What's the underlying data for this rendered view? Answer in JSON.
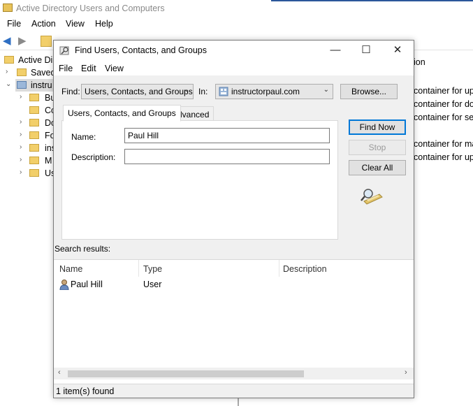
{
  "background_window": {
    "title": "Active Directory Users and Computers",
    "menu": [
      "File",
      "Action",
      "View",
      "Help"
    ],
    "tree": [
      {
        "label": "Active Dir",
        "chevron": ""
      },
      {
        "label": "Saved",
        "chevron": "›"
      },
      {
        "label": "instru",
        "chevron": "⌄"
      },
      {
        "label": "Bu",
        "chevron": "›"
      },
      {
        "label": "Co",
        "chevron": ""
      },
      {
        "label": "Do",
        "chevron": "›"
      },
      {
        "label": "Fo",
        "chevron": "›"
      },
      {
        "label": "ins",
        "chevron": "›"
      },
      {
        "label": "M",
        "chevron": "›"
      },
      {
        "label": "Us",
        "chevron": "›"
      }
    ],
    "right_pane_text": [
      "ion",
      "container for up",
      "container for do",
      "container for sec",
      "container for ma",
      "container for up"
    ]
  },
  "dialog": {
    "title": "Find Users, Contacts, and Groups",
    "menu": [
      "File",
      "Edit",
      "View"
    ],
    "find_label": "Find:",
    "find_value": "Users, Contacts, and Groups",
    "in_label": "In:",
    "in_value": "instructorpaul.com",
    "browse_button": "Browse...",
    "tabs": [
      "Users, Contacts, and Groups",
      "Advanced"
    ],
    "name_label": "Name:",
    "name_value": "Paul Hill",
    "description_label": "Description:",
    "description_value": "",
    "find_now_button": "Find Now",
    "stop_button": "Stop",
    "clear_all_button": "Clear All",
    "search_results_label": "Search results:",
    "columns": [
      "Name",
      "Type",
      "Description"
    ],
    "rows": [
      {
        "name": "Paul Hill",
        "type": "User",
        "description": ""
      }
    ],
    "status": "1 item(s) found"
  },
  "icons": {
    "dialog_icon": "find-icon",
    "search_graphic": "magnifier-icon",
    "user_icon": "user-icon"
  }
}
